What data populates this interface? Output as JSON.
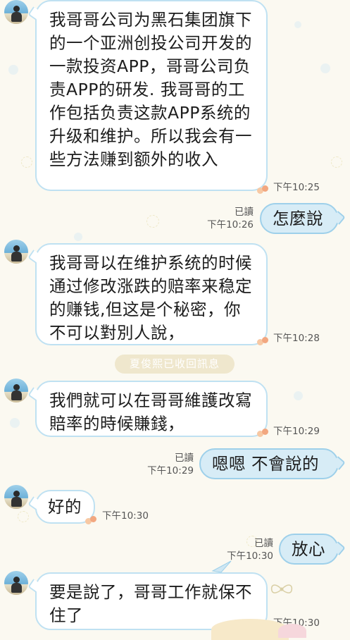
{
  "messages": [
    {
      "text": "我哥哥公司为黑石集团旗下的一个亚洲创投公司开发的一款投资APP，哥哥公司负责APP的研发. 我哥哥的工作包括负责这款APP系统的升级和维护。所以我会有一些方法赚到额外的收入",
      "time": "下午10:25"
    },
    {
      "text": "怎麼說",
      "read": "已讀",
      "time": "下午10:26"
    },
    {
      "text": "我哥哥以在维护系统的时候通过修改涨跌的赔率来稳定的赚钱,但这是个秘密，你不可以對別人說，",
      "time": "下午10:28"
    },
    {
      "text": "我們就可以在哥哥維護改寫賠率的時候賺錢，",
      "time": "下午10:29"
    },
    {
      "text": "嗯嗯 不會說的",
      "read": "已讀",
      "time": "下午10:29"
    },
    {
      "text": "好的",
      "time": "下午10:30"
    },
    {
      "text": "放心",
      "read": "已讀",
      "time": "下午10:30"
    },
    {
      "text": "要是說了，哥哥工作就保不住了",
      "time": "下午10:30"
    }
  ],
  "notice": "夏俊熙已收回訊息",
  "colors": {
    "background": "#fbf9f1",
    "in_border": "#bfe1f2",
    "out_fill": "#d7ecf6",
    "out_border": "#9ed0ea"
  }
}
